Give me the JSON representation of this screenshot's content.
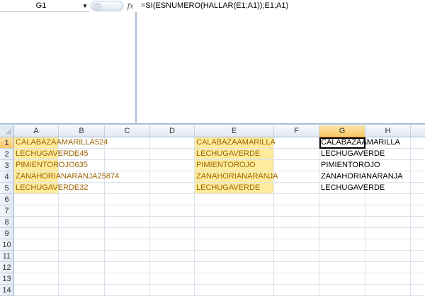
{
  "formula_bar": {
    "name_box": "G1",
    "fx_label": "fx",
    "formula": "=SI(ESNUMERO(HALLAR(E1;A1));E1;A1)"
  },
  "columns": [
    "A",
    "B",
    "C",
    "D",
    "E",
    "F",
    "G",
    "H",
    ""
  ],
  "selected_column": "G",
  "rows": [
    "1",
    "2",
    "3",
    "4",
    "5",
    "6",
    "7",
    "8",
    "9",
    "10",
    "11",
    "12",
    "13",
    "14"
  ],
  "selected_row": "1",
  "active_cell": "G1",
  "highlight_color": "#ffeb9c",
  "highlight_text_color": "#9c6500",
  "cells": {
    "A": [
      "CALABAZAAMARILLA524",
      "LECHUGAVERDE45",
      "PIMIENTOROJO635",
      "ZANAHORIANARANJA25874",
      "LECHUGAVERDE32"
    ],
    "E": [
      "CALABAZAAMARILLA",
      "LECHUGAVERDE",
      "PIMIENTOROJO",
      "ZANAHORIANARANJA",
      "LECHUGAVERDE"
    ],
    "G": [
      "CALABAZAAMARILLA",
      "LECHUGAVERDE",
      "PIMIENTOROJO",
      "ZANAHORIANARANJA",
      "LECHUGAVERDE"
    ]
  }
}
